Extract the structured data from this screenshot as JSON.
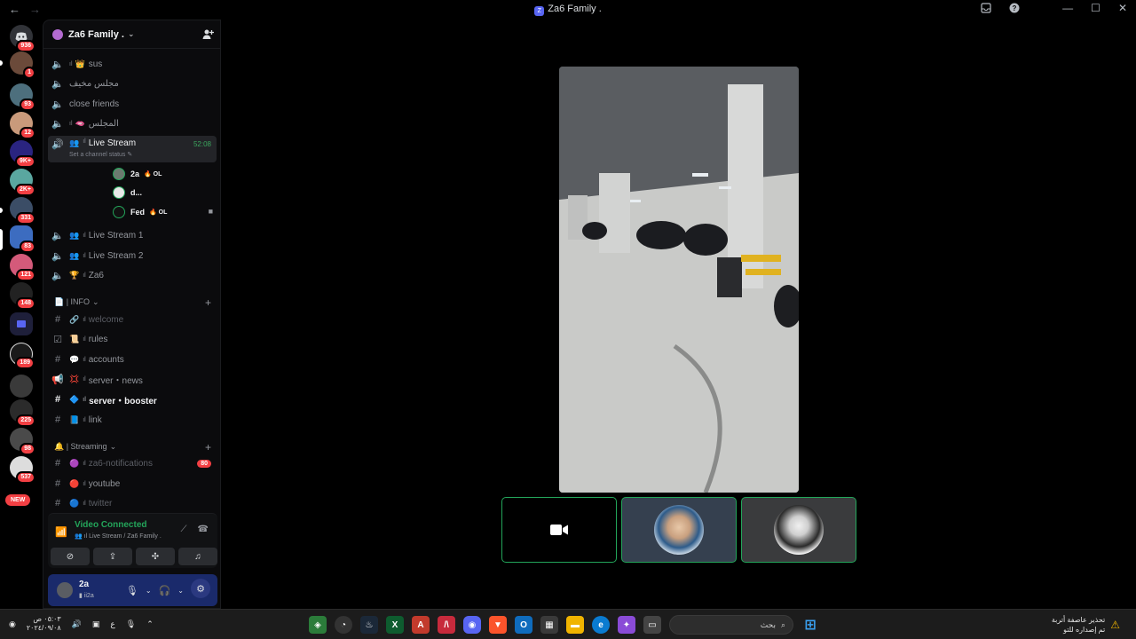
{
  "window": {
    "title": "Za6 Family .",
    "nav_back": "←",
    "nav_forward": "→"
  },
  "rail": {
    "badges": [
      "936",
      "1",
      "93",
      "12",
      "9K+",
      "2K+",
      "331",
      "83",
      "121",
      "148",
      "189",
      "225",
      "98",
      "537"
    ],
    "new_label": "NEW"
  },
  "guild": {
    "name": "Za6 Family ."
  },
  "channels": [
    {
      "name": "sus",
      "emoji": "👑",
      "bar": "ıl"
    },
    {
      "name": "مجلس مخيف",
      "emoji": "",
      "bar": ""
    },
    {
      "name": "close friends",
      "emoji": "",
      "bar": ""
    },
    {
      "name": "المجلس",
      "emoji": "🫦",
      "bar": "ıl"
    },
    {
      "name": "Live Stream",
      "emoji": "👥",
      "bar": "ıl",
      "time": "52:08",
      "status": "Set a channel status"
    },
    {
      "name": "Live Stream 1",
      "emoji": "👥",
      "bar": "ıl"
    },
    {
      "name": "Live Stream 2",
      "emoji": "👥",
      "bar": "ıl"
    },
    {
      "name": "Za6",
      "emoji": "🏆",
      "bar": "ıl"
    }
  ],
  "voice_users": [
    {
      "name": "2a",
      "tag": "🔥 OL"
    },
    {
      "name": "d...",
      "tag": ""
    },
    {
      "name": "Fed",
      "tag": "🔥 OL"
    }
  ],
  "categories": {
    "info": "📄 | INFO",
    "streaming": "🔔 | Streaming"
  },
  "info_channels": [
    {
      "name": "welcome",
      "emoji": "🔗",
      "bar": "ıl"
    },
    {
      "name": "rules",
      "emoji": "📜",
      "bar": "ıl"
    },
    {
      "name": "accounts",
      "emoji": "💬",
      "bar": "ıl"
    },
    {
      "name": "server・news",
      "emoji": "💢",
      "bar": "ıl"
    },
    {
      "name": "server・booster",
      "emoji": "🔷",
      "bar": "ıl"
    },
    {
      "name": "link",
      "emoji": "📘",
      "bar": "ıl"
    }
  ],
  "streaming_channels": [
    {
      "name": "za6-notifications",
      "emoji": "🟣",
      "bar": "ıl",
      "badge": "80"
    },
    {
      "name": "youtube",
      "emoji": "🔴",
      "bar": "ıl"
    },
    {
      "name": "twitter",
      "emoji": "🔵",
      "bar": "ıl"
    }
  ],
  "voice_panel": {
    "title": "Video Connected",
    "subtitle": "👥 ıl Live Stream / Za6 Family ."
  },
  "user": {
    "name": "2a",
    "status": "ii2a"
  },
  "taskbar": {
    "time": "٠٥:٠٣ ص",
    "date": "٢٠٢٤/٠٩/٠٨",
    "lang": "ع",
    "search_placeholder": "بحث",
    "notif_title": "تحذير عاصفة أتربة",
    "notif_sub": "تم إصداره للتو"
  }
}
